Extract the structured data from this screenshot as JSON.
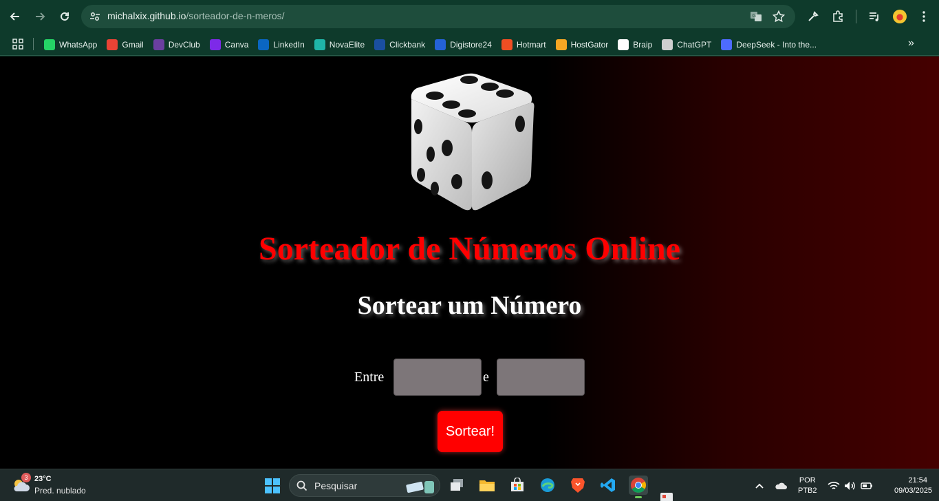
{
  "browser": {
    "url_host": "michalxix.github.io",
    "url_path": "/sorteador-de-n-meros/"
  },
  "bookmarks": [
    {
      "label": "WhatsApp",
      "icon": "whatsapp-icon",
      "color": "#25d366"
    },
    {
      "label": "Gmail",
      "icon": "gmail-icon",
      "color": "#ea4335"
    },
    {
      "label": "DevClub",
      "icon": "devclub-icon",
      "color": "#6b3fa0"
    },
    {
      "label": "Canva",
      "icon": "canva-icon",
      "color": "#7d2ae8"
    },
    {
      "label": "LinkedIn",
      "icon": "linkedin-icon",
      "color": "#0a66c2"
    },
    {
      "label": "NovaElite",
      "icon": "novaelite-icon",
      "color": "#1fb5a8"
    },
    {
      "label": "Clickbank",
      "icon": "clickbank-icon",
      "color": "#1a4fa0"
    },
    {
      "label": "Digistore24",
      "icon": "digistore24-icon",
      "color": "#2462d8"
    },
    {
      "label": "Hotmart",
      "icon": "hotmart-icon",
      "color": "#f04e23"
    },
    {
      "label": "HostGator",
      "icon": "hostgator-icon",
      "color": "#f5a623"
    },
    {
      "label": "Braip",
      "icon": "braip-icon",
      "color": "#ffffff"
    },
    {
      "label": "ChatGPT",
      "icon": "chatgpt-icon",
      "color": "#cfcfcf"
    },
    {
      "label": "DeepSeek - Into the...",
      "icon": "deepseek-icon",
      "color": "#4d6bfe"
    }
  ],
  "page": {
    "title": "Sorteador de Números Online",
    "subtitle": "Sortear um Número",
    "label_from": "Entre",
    "label_and": "e",
    "min_value": "",
    "max_value": "",
    "button_label": "Sortear!",
    "accent_color": "#ff0000"
  },
  "taskbar": {
    "weather_badge": "3",
    "temperature": "23°C",
    "condition": "Pred. nublado",
    "search_placeholder": "Pesquisar",
    "lang_line1": "POR",
    "lang_line2": "PTB2",
    "time": "21:54",
    "date": "09/03/2025"
  }
}
